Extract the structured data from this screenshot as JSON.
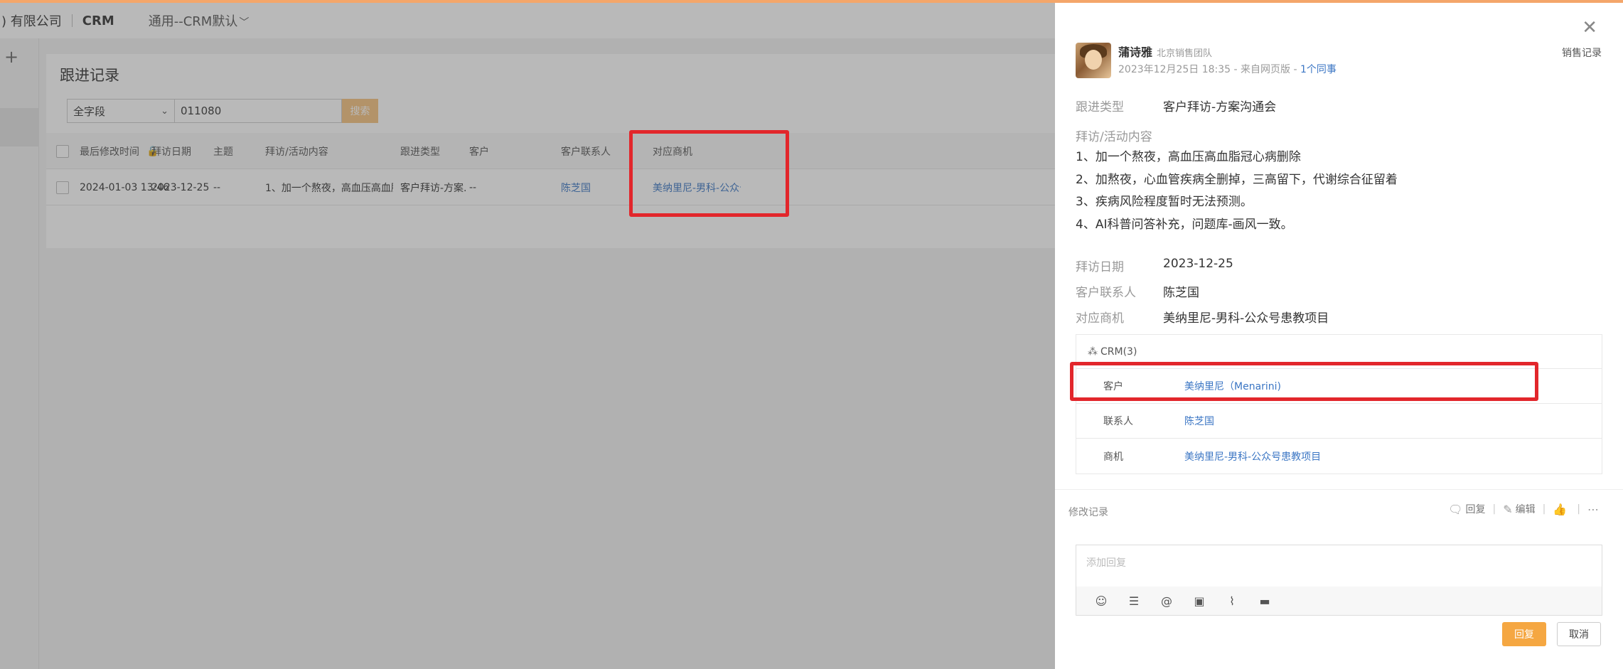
{
  "topbar": {
    "company": ") 有限公司",
    "app": "CRM",
    "view": "通用--CRM默认",
    "view_chevron": "﹀"
  },
  "leftnav": {
    "add_icon": "+"
  },
  "list": {
    "title": "跟进记录",
    "filter_field": "全字段",
    "filter_chevron": "⌄",
    "keyword": "011080",
    "search_label": "搜索",
    "columns": [
      "最后修改时间",
      "拜访日期",
      "主题",
      "拜访/活动内容",
      "跟进类型",
      "客户",
      "客户联系人",
      "对应商机"
    ],
    "lock_icon": "🔒",
    "rows": [
      {
        "modified": "2024-01-03 13:46",
        "visit_date": "2023-12-25",
        "subject": "--",
        "content": "1、加一个熬夜，高血压高血脂冠心...",
        "type": "客户拜访-方案...",
        "customer": "--",
        "contact": "陈芝国",
        "opportunity": "美纳里尼-男科-公众号..."
      }
    ]
  },
  "drawer": {
    "close_icon": "✕",
    "author": "蒲诗雅",
    "team": "北京销售团队",
    "tag": "销售记录",
    "meta_prefix": "2023年12月25日 18:35 - 来自网页版 - ",
    "meta_colleagues": "1个同事",
    "follow_type_label": "跟进类型",
    "follow_type": "客户拜访-方案沟通会",
    "content_label": "拜访/活动内容",
    "content_lines": [
      "1、加一个熬夜，高血压高血脂冠心病删除",
      "2、加熬夜，心血管疾病全删掉，三高留下，代谢综合征留着",
      "3、疾病风险程度暂时无法预测。",
      "4、AI科普问答补充，问题库-画风一致。"
    ],
    "visit_date_label": "拜访日期",
    "visit_date": "2023-12-25",
    "contact_label": "客户联系人",
    "contact": "陈芝国",
    "opportunity_label": "对应商机",
    "opportunity": "美纳里尼-男科-公众号患教项目",
    "crm": {
      "icon": "⁂",
      "title": "CRM(3)",
      "rows": [
        {
          "key": "客户",
          "value": "美纳里尼（Menarini)"
        },
        {
          "key": "联系人",
          "value": "陈芝国"
        },
        {
          "key": "商机",
          "value": "美纳里尼-男科-公众号患教项目"
        }
      ]
    },
    "modify_log": "修改记录",
    "actions": {
      "reply_icon": "🗨",
      "reply": "回复",
      "edit_icon": "✎",
      "edit": "编辑",
      "like_icon": "👍",
      "more_icon": "⋯"
    },
    "reply_placeholder": "添加回复",
    "toolbar_icons": {
      "emoji": "☺",
      "list": "☰",
      "mention": "@",
      "image": "▣",
      "attach": "⌇",
      "keyboard": "▬"
    },
    "submit": "回复",
    "cancel": "取消"
  }
}
